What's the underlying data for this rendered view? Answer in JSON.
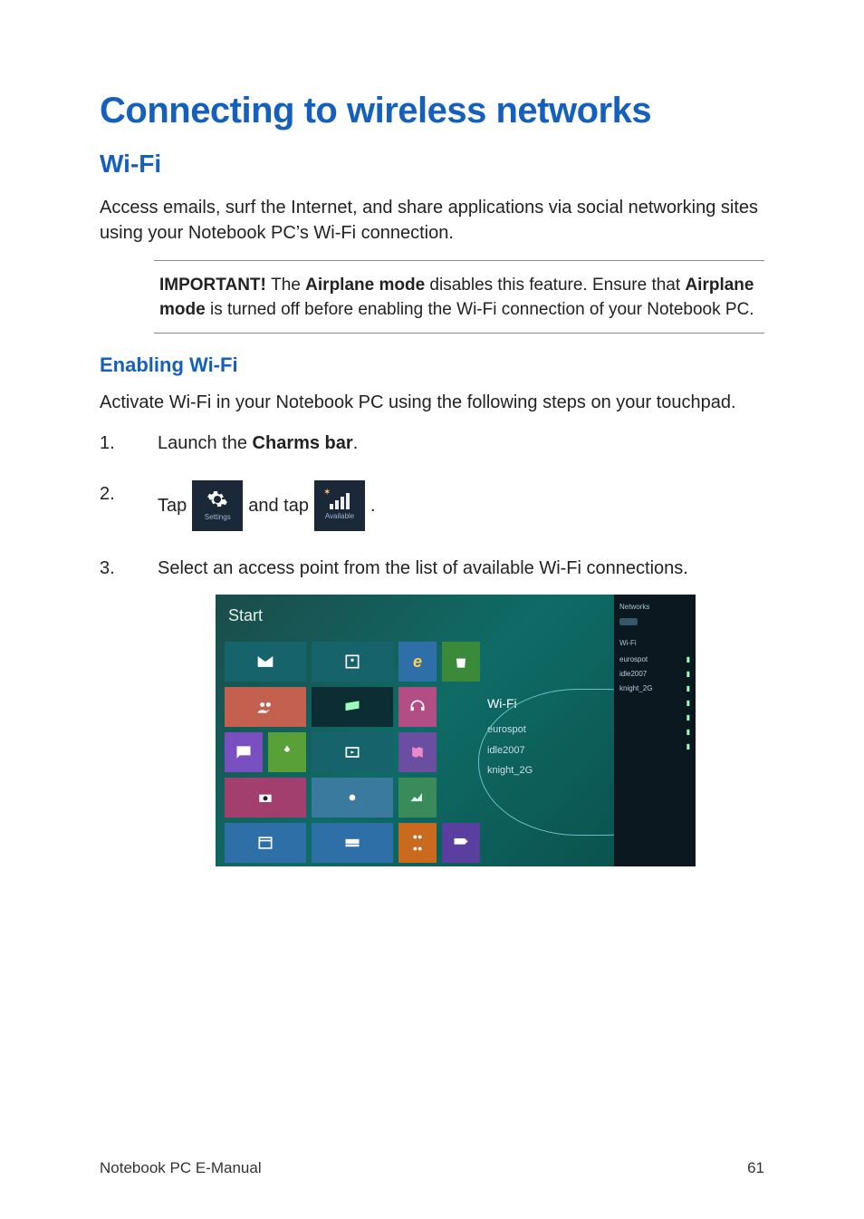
{
  "headings": {
    "h1": "Connecting to wireless networks",
    "h2": "Wi-Fi",
    "h3": "Enabling Wi-Fi"
  },
  "paragraphs": {
    "intro": "Access emails, surf the Internet, and share applications via social networking sites using your Notebook PC’s Wi-Fi connection.",
    "enable_intro": "Activate Wi-Fi in your Notebook PC using the following steps on your touchpad."
  },
  "important_note": {
    "label": "IMPORTANT! ",
    "part1": "The ",
    "bold1": "Airplane mode",
    "part2": " disables this feature. Ensure that ",
    "bold2": "Airplane mode",
    "part3": " is turned off before enabling the Wi-Fi connection of your Notebook PC."
  },
  "steps": {
    "s1_pre": "Launch the ",
    "s1_bold": "Charms bar",
    "s1_post": ".",
    "s2_pre": "Tap",
    "s2_mid": "and tap",
    "s2_post": ".",
    "s3": "Select an access point from the list of available Wi-Fi connections."
  },
  "icons": {
    "settings_caption": "Settings",
    "available_caption": "Available"
  },
  "screenshot": {
    "start": "Start",
    "networks_panel": {
      "header": "Networks",
      "wifi_label": "Wi-Fi",
      "items": [
        "eurospot",
        "idle2007",
        "knight_2G"
      ]
    },
    "popup": {
      "title": "Wi-Fi",
      "rows": [
        "eurospot",
        "idle2007",
        "knight_2G"
      ]
    }
  },
  "footer": {
    "left": "Notebook PC E-Manual",
    "right": "61"
  }
}
